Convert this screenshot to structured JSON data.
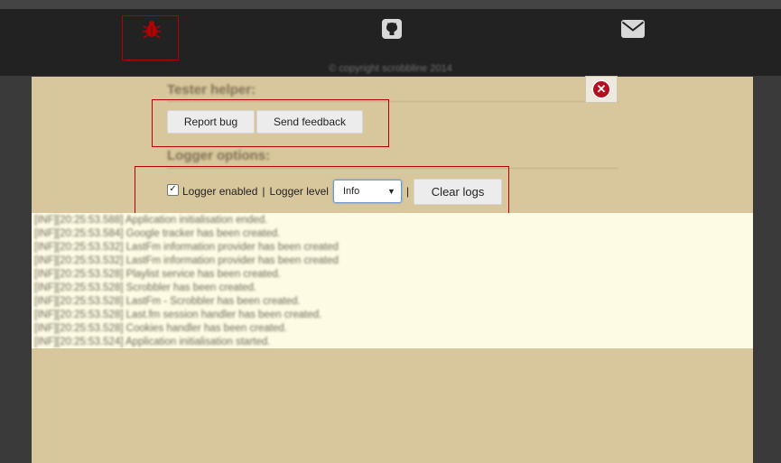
{
  "header": {
    "icons": [
      "bug-icon",
      "github-icon",
      "mail-icon"
    ],
    "copyright": "© copyright scrobbline 2014"
  },
  "tester": {
    "title": "Tester helper:",
    "report_bug": "Report bug",
    "send_feedback": "Send feedback",
    "close_icon": "close-icon"
  },
  "logger": {
    "title": "Logger options:",
    "enabled_label": "Logger enabled",
    "enabled": true,
    "separator": "|",
    "level_label": "Logger level",
    "level_value": "Info",
    "clear_label": "Clear logs"
  },
  "logs": [
    "[INF][20:25:53.588] Application initialisation ended.",
    "[INF][20:25:53.584] Google tracker has been created.",
    "[INF][20:25:53.532] LastFm information provider has been created",
    "[INF][20:25:53.532] LastFm information provider has been created",
    "[INF][20:25:53.528] Playlist service has been created.",
    "[INF][20:25:53.528] Scrobbler has been created.",
    "[INF][20:25:53.528] LastFm - Scrobbler has been created.",
    "[INF][20:25:53.528] Last.fm session handler has been created.",
    "[INF][20:25:53.528] Cookies handler has been created.",
    "[INF][20:25:53.524] Application initialisation started."
  ],
  "colors": {
    "bug_icon": "#b30000",
    "header_bg": "#222222",
    "panel_bg": "#d8c79c",
    "log_bg": "#fdfbe4",
    "highlight": "#b30000"
  }
}
